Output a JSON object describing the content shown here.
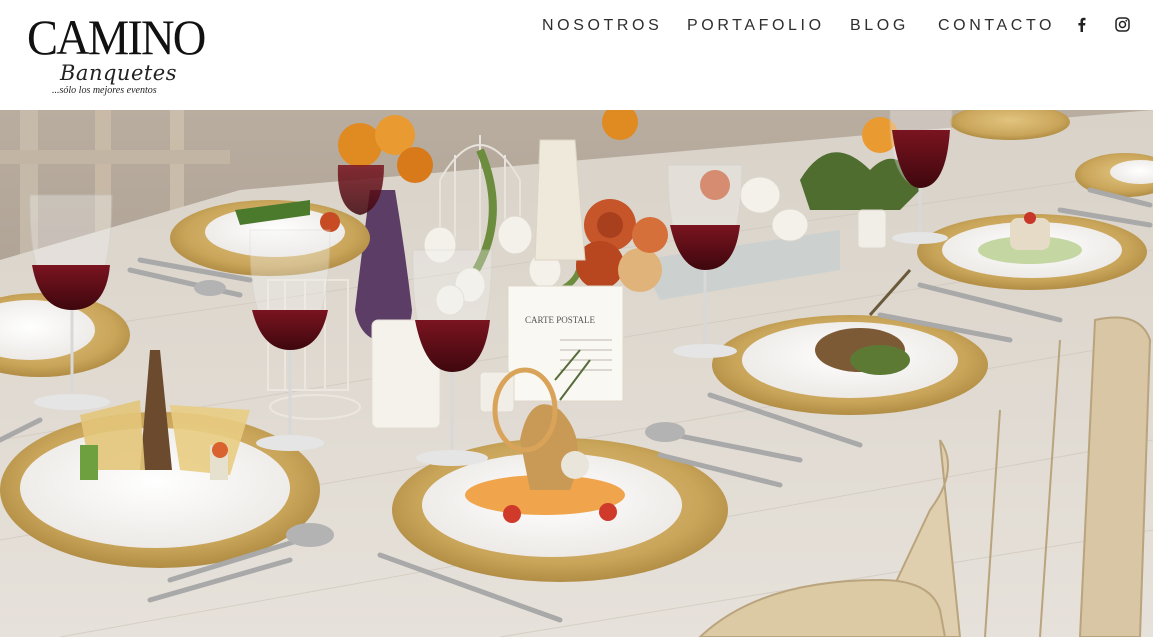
{
  "brand": {
    "name": "CAMINO",
    "script": "Banquetes",
    "tagline": "...sólo los mejores eventos"
  },
  "nav": {
    "items": [
      {
        "label": "NOSOTROS"
      },
      {
        "label": "PORTAFOLIO"
      },
      {
        "label": "BLOG"
      },
      {
        "label": "CONTACTO"
      }
    ]
  },
  "social": {
    "facebook_icon": "facebook-icon",
    "instagram_icon": "instagram-icon"
  },
  "hero": {
    "card_text": "CARTE POSTALE",
    "colors": {
      "table": "#ddd6cc",
      "charger_gold": "#c9a85a",
      "wine": "#5a0e14",
      "roses": "#c8552a"
    }
  }
}
